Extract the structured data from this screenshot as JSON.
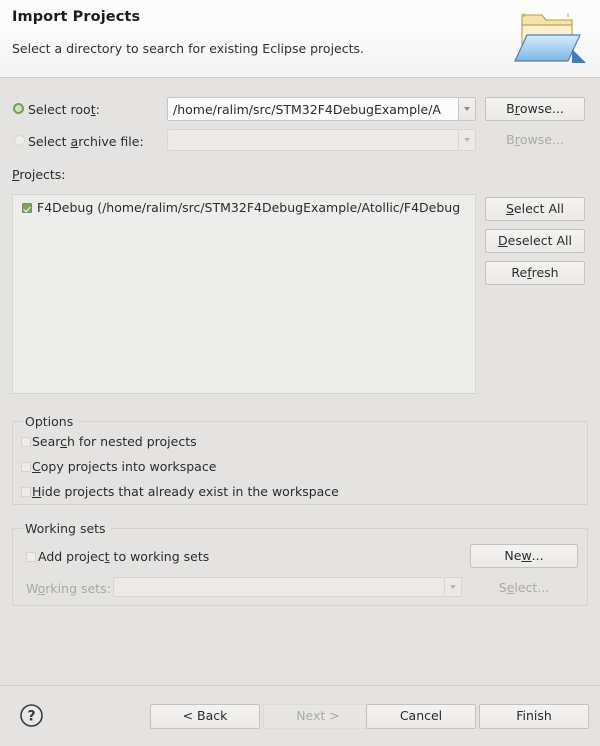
{
  "header": {
    "title": "Import Projects",
    "subtitle": "Select a directory to search for existing Eclipse projects.",
    "icon": "open-folder-icon"
  },
  "source": {
    "root_directory": {
      "label_pre": "Select roo",
      "label_mnemonic": "t",
      "label_post": ":",
      "selected": true,
      "value": "/home/ralim/src/STM32F4DebugExample/A",
      "browse_pre": "B",
      "browse_mnemonic": "r",
      "browse_post": "owse...",
      "browse_enabled": true
    },
    "archive_file": {
      "label_pre": "Select ",
      "label_mnemonic": "a",
      "label_post": "rchive file:",
      "selected": false,
      "value": "",
      "browse_pre": "B",
      "browse_mnemonic": "r",
      "browse_post": "owse...",
      "browse_enabled": false
    }
  },
  "projects": {
    "label_pre": "",
    "label_mnemonic": "P",
    "label_post": "rojects:",
    "items": [
      {
        "checked": true,
        "text": "F4Debug (/home/ralim/src/STM32F4DebugExample/Atollic/F4Debug"
      }
    ],
    "buttons": [
      {
        "pre": "",
        "mnemonic": "S",
        "post": "elect All",
        "enabled": true,
        "name": "select-all-button"
      },
      {
        "pre": "",
        "mnemonic": "D",
        "post": "eselect All",
        "enabled": true,
        "name": "deselect-all-button"
      },
      {
        "pre": "Re",
        "mnemonic": "f",
        "post": "resh",
        "enabled": true,
        "name": "refresh-button"
      }
    ]
  },
  "options": {
    "title": "Options",
    "checkboxes": [
      {
        "checked": false,
        "pre": "Sear",
        "mnemonic": "c",
        "post": "h for nested projects",
        "name": "search-nested-projects-checkbox"
      },
      {
        "checked": false,
        "pre": "",
        "mnemonic": "C",
        "post": "opy projects into workspace",
        "name": "copy-projects-checkbox"
      },
      {
        "checked": false,
        "pre": "",
        "mnemonic": "H",
        "post": "ide projects that already exist in the workspace",
        "name": "hide-existing-projects-checkbox"
      }
    ]
  },
  "working_sets": {
    "title": "Working sets",
    "add_checkbox": {
      "checked": false,
      "pre": "Add projec",
      "mnemonic": "t",
      "post": " to working sets"
    },
    "combo_label_pre": "W",
    "combo_label_mnemonic": "o",
    "combo_label_post": "rking sets:",
    "combo_value": "",
    "combo_enabled": false,
    "new_button": {
      "pre": "Ne",
      "mnemonic": "w",
      "post": "...",
      "enabled": true
    },
    "select_button": {
      "pre": "S",
      "mnemonic": "e",
      "post": "lect...",
      "enabled": false
    }
  },
  "footer": {
    "help_icon": "help-question-icon",
    "buttons": [
      {
        "label": "< Back",
        "enabled": true,
        "name": "back-button"
      },
      {
        "label": "Next >",
        "enabled": false,
        "name": "next-button"
      },
      {
        "label": "Cancel",
        "enabled": true,
        "name": "cancel-button"
      },
      {
        "label": "Finish",
        "enabled": true,
        "name": "finish-button"
      }
    ]
  }
}
